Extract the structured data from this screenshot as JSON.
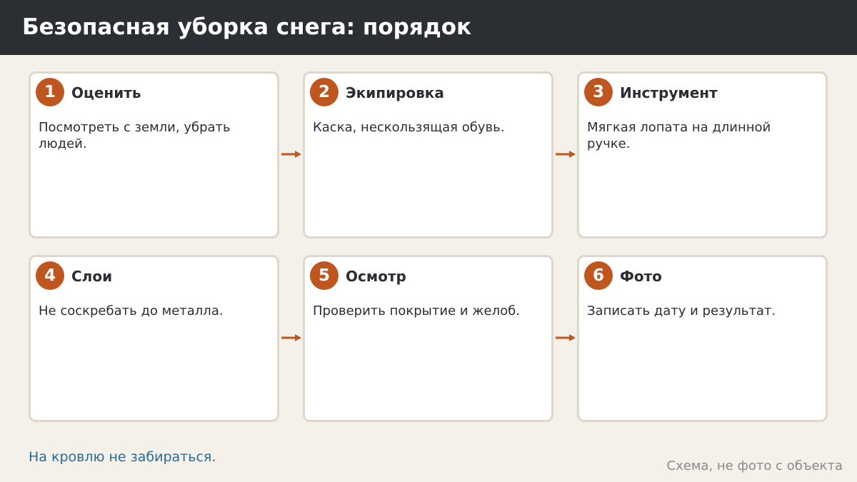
{
  "header": {
    "title": "Безопасная уборка снега: порядок"
  },
  "steps": [
    {
      "number": "1",
      "title": "Оценить",
      "text": "Посмотреть с земли, убрать людей."
    },
    {
      "number": "2",
      "title": "Экипировка",
      "text": "Каска, нескользящая обувь."
    },
    {
      "number": "3",
      "title": "Инструмент",
      "text": "Мягкая лопата на длинной ручке."
    },
    {
      "number": "4",
      "title": "Слои",
      "text": "Не соскребать до металла."
    },
    {
      "number": "5",
      "title": "Осмотр",
      "text": "Проверить покрытие и желоб."
    },
    {
      "number": "6",
      "title": "Фото",
      "text": "Записать дату и результат."
    }
  ],
  "footer": {
    "note": "На кровлю не забираться.",
    "caption": "Схема, не фото с объекта"
  },
  "colors": {
    "header_bg": "#2b2e33",
    "accent": "#c0561f",
    "note": "#2d6a93",
    "card_border": "#ddd7cc",
    "page_bg": "#f4f1eb"
  }
}
